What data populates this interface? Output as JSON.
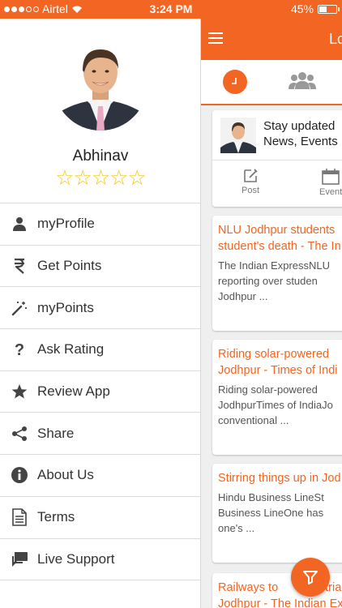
{
  "status_bar": {
    "carrier": "Airtel",
    "time": "3:24 PM",
    "battery": "45%",
    "battery_level": 0.45,
    "signal_bars_filled": 3,
    "signal_bars_total": 5
  },
  "drawer": {
    "user_name": "Abhinav",
    "rating_stars": "☆☆☆☆☆",
    "rating_value": 0,
    "rating_max": 5,
    "menu": [
      {
        "label": "myProfile",
        "icon": "person-icon"
      },
      {
        "label": "Get Points",
        "icon": "rupee-icon"
      },
      {
        "label": "myPoints",
        "icon": "magic-wand-icon"
      },
      {
        "label": "Ask Rating",
        "icon": "question-icon"
      },
      {
        "label": "Review App",
        "icon": "star-icon"
      },
      {
        "label": "Share",
        "icon": "share-icon"
      },
      {
        "label": "About Us",
        "icon": "info-icon"
      },
      {
        "label": "Terms",
        "icon": "document-icon"
      },
      {
        "label": "Live Support",
        "icon": "chat-icon"
      }
    ]
  },
  "main": {
    "title": "Lo",
    "tabs": [
      {
        "icon": "clock-icon",
        "active": true
      },
      {
        "icon": "group-icon",
        "active": false
      }
    ],
    "composer": {
      "line1": "Stay updated",
      "line2": "News, Events",
      "post_label": "Post",
      "event_label": "Event"
    },
    "news": [
      {
        "title1": "NLU Jodhpur students",
        "title2": "student's death - The In",
        "body1": "The Indian ExpressNLU",
        "body2": "reporting over studen",
        "body3": "Jodhpur ..."
      },
      {
        "title1": "Riding solar-powered",
        "title2": "Jodhpur - Times of Indi",
        "body1": "Riding solar-powered",
        "body2": "JodhpurTimes of IndiaJo",
        "body3": "conventional ..."
      },
      {
        "title1": "Stirring things up in Jod",
        "title2": "",
        "body1": "Hindu Business LineSt",
        "body2": "Business LineOne has",
        "body3": "one's ..."
      },
      {
        "title1": "Railways to",
        "title1b": "tria",
        "title2": "Jodhpur - The Indian Ex",
        "body1": "",
        "body2": "",
        "body3": ""
      }
    ]
  },
  "colors": {
    "accent": "#f26522",
    "star": "#f5c518"
  }
}
